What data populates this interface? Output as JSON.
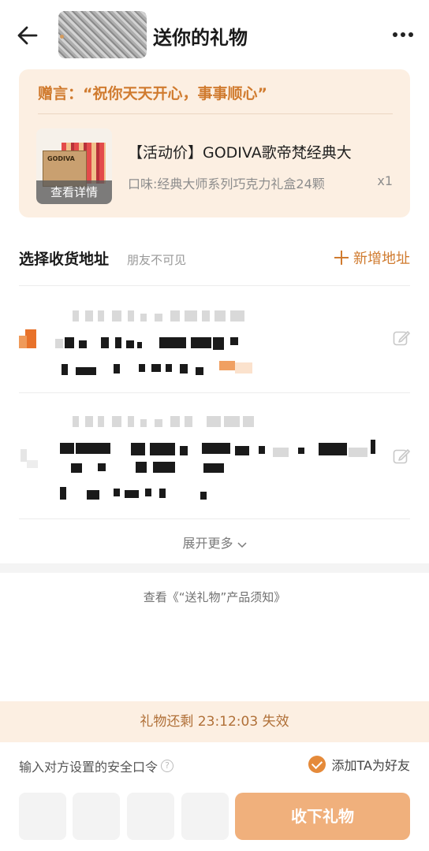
{
  "header": {
    "title": "送你的礼物",
    "back_icon": "back-arrow-icon",
    "more_icon": "more-dots-icon"
  },
  "gift": {
    "message": "赠言：“祝你天天开心，事事顺心”",
    "image_label": "查看详情",
    "image_brand": "GODIVA",
    "product_name": "【活动价】GODIVA歌帝梵经典大",
    "flavor": "口味:经典大师系列巧克力礼盒24颗",
    "quantity": "x1"
  },
  "address": {
    "title": "选择收货地址",
    "subtitle": "朋友不可见",
    "add_label": "新增地址",
    "expand_label": "展开更多"
  },
  "notice": "查看《“送礼物”产品须知》",
  "bottom": {
    "timer_text": "礼物还剩 23:12:03 失效",
    "password_label": "输入对方设置的安全口令",
    "add_friend_label": "添加TA为好友",
    "receive_label": "收下礼物"
  },
  "colors": {
    "accent": "#d07b2f",
    "card_bg": "#fcefe2",
    "button": "#f0b07c"
  }
}
